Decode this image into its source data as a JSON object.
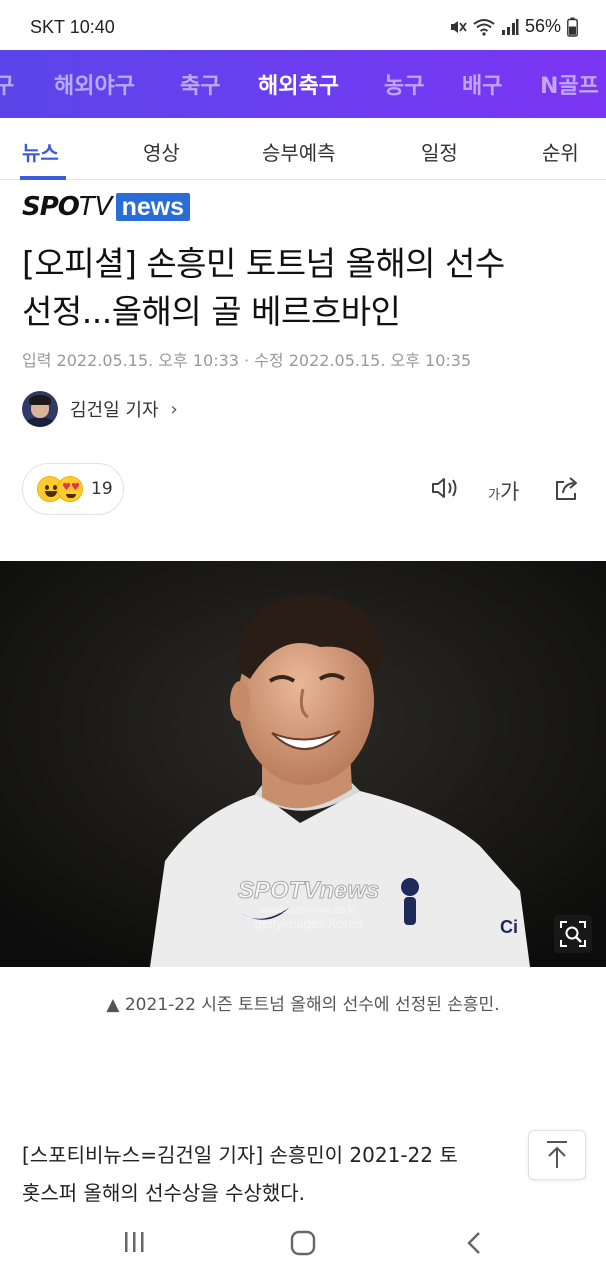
{
  "status_bar": {
    "carrier": "SKT",
    "time": "10:40",
    "battery": "56%"
  },
  "categories": [
    {
      "label": "구",
      "active": false
    },
    {
      "label": "해외야구",
      "active": false
    },
    {
      "label": "축구",
      "active": false
    },
    {
      "label": "해외축구",
      "active": true
    },
    {
      "label": "농구",
      "active": false
    },
    {
      "label": "배구",
      "active": false
    },
    {
      "label": "N골프",
      "active": false
    }
  ],
  "sub_tabs": [
    {
      "label": "뉴스",
      "active": true
    },
    {
      "label": "영상",
      "active": false
    },
    {
      "label": "승부예측",
      "active": false
    },
    {
      "label": "일정",
      "active": false
    },
    {
      "label": "순위",
      "active": false
    }
  ],
  "logo": {
    "part1": "SPO",
    "part2": "TV",
    "part3": "news"
  },
  "article": {
    "headline_line1": "[오피셜] 손흥민 토트넘 올해의 선수",
    "headline_line2": "선정...올해의 골 베르흐바인",
    "meta": "입력 2022.05.15. 오후 10:33 · 수정 2022.05.15. 오후 10:35",
    "reporter": "김건일 기자",
    "reaction_count": "19",
    "font_small": "가",
    "font_big": "가",
    "caption": "▲ 2021-22 시즌 토트넘 올해의 선수에 선정된 손흥민.",
    "body_line1": "[스포티비뉴스=김건일 기자] 손흥민이 2021-22 토",
    "body_line2": "홋스퍼 올해의 선수상을 수상했다."
  },
  "photo": {
    "watermark_logo": "SPOTVnews",
    "watermark_site": "www.spotvnews.co.kr",
    "watermark_credit": "gettyimages Korea"
  },
  "icons": {
    "speaker": "speaker-icon",
    "share": "share-icon",
    "zoom": "zoom-icon",
    "scroll_top": "arrow-up-icon"
  },
  "colors": {
    "category_bar": "#6a3ff0",
    "active_tab": "#3b5bdb",
    "news_badge": "#2b6dd6"
  }
}
